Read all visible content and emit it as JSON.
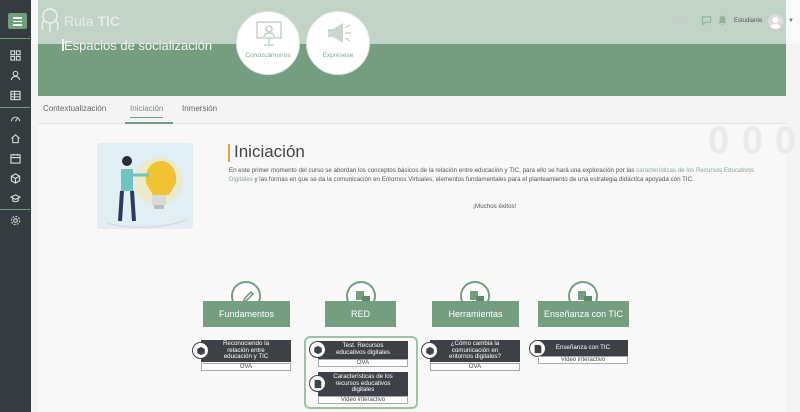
{
  "app": {
    "logo_text_prefix": "Ruta",
    "logo_text_bold": "TIC"
  },
  "header": {
    "user_name": "Estudiante",
    "caret": "▼"
  },
  "banner": {
    "title": "Espacios de socialización",
    "bubbles": [
      {
        "label": "Conozcámonos",
        "icon": "presentation-icon"
      },
      {
        "label": "Exprésese",
        "icon": "megaphone-icon"
      }
    ]
  },
  "tabs": [
    {
      "label": "Contextualización",
      "active": false
    },
    {
      "label": "Iniciación",
      "active": true
    },
    {
      "label": "Inmersión",
      "active": false
    }
  ],
  "section": {
    "title": "Iniciación",
    "intro_before": "En este primer momento del curso se abordan los conceptos básicos de la relación entre educación y TIC, para ello se hará una exploración por las ",
    "intro_link": "características de los Recursos Educativos Digitales",
    "intro_after": " y las formas en que se da la comunicación en Entornos Virtuales, elementos fundamentales para el planteamiento de una estrategia didáctica apoyada con TIC.",
    "cheer": "¡Muchos éxitos!"
  },
  "categories": [
    {
      "label": "Fundamentos",
      "icon": "pencil-icon"
    },
    {
      "label": "RED",
      "icon": "docs-icon"
    },
    {
      "label": "Herramientas",
      "icon": "docs-icon"
    },
    {
      "label": "Enseñanza con TIC",
      "icon": "docs-icon"
    }
  ],
  "items": {
    "fundamentos": [
      {
        "title_l1": "Reconociendo la",
        "title_l2": "relación entre",
        "title_l3": "educación y TIC",
        "type": "OVA"
      }
    ],
    "red": [
      {
        "title_l1": "Test. Recursos",
        "title_l2": "educativos digitales",
        "type": "OVA"
      },
      {
        "title_l1": "Características de los",
        "title_l2": "recursos educativos",
        "title_l3": "digitales",
        "type": "Video interactivo"
      }
    ],
    "herramientas": [
      {
        "title_l1": "¿Cómo cambia la",
        "title_l2": "comunicación en",
        "title_l3": "entornos digitales?",
        "type": "OVA"
      }
    ],
    "ensenanza": [
      {
        "title_l1": "Enseñanza con TIC",
        "type": "Video interactivo"
      }
    ]
  },
  "colors": {
    "accent_green": "#759e80",
    "sidebar": "#353c40",
    "dark_card": "#3d4044",
    "highlight_orange": "#e8a24b"
  }
}
